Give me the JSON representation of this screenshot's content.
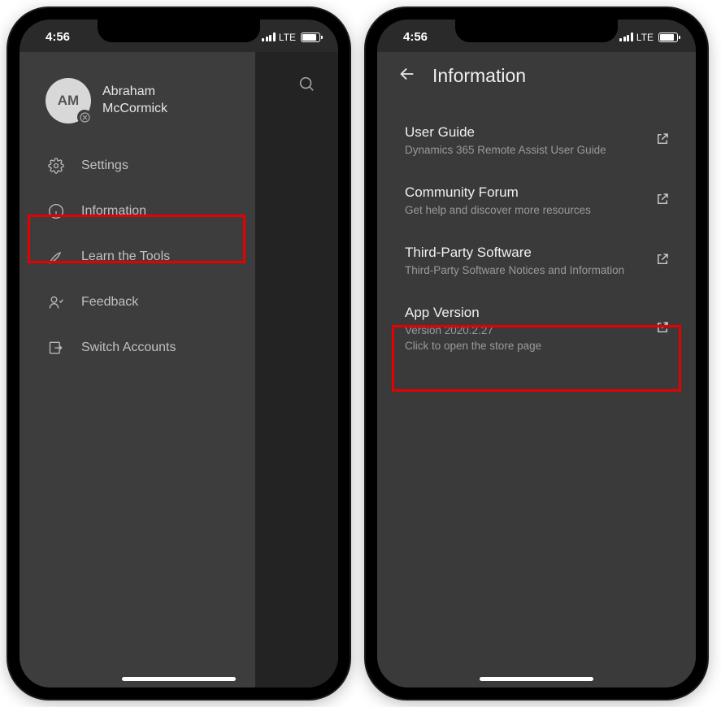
{
  "status": {
    "time": "4:56",
    "network": "LTE"
  },
  "left": {
    "avatar_initials": "AM",
    "user_first": "Abraham",
    "user_last": "McCormick",
    "menu": {
      "settings": "Settings",
      "information": "Information",
      "learn": "Learn the Tools",
      "feedback": "Feedback",
      "switch": "Switch Accounts"
    }
  },
  "right": {
    "header": "Information",
    "items": {
      "user_guide": {
        "title": "User Guide",
        "sub": "Dynamics 365 Remote Assist User Guide"
      },
      "community": {
        "title": "Community Forum",
        "sub": "Get help and discover more resources"
      },
      "third_party": {
        "title": "Third-Party Software",
        "sub": "Third-Party Software Notices and Information"
      },
      "app_version": {
        "title": "App Version",
        "sub1": "Version 2020.2.27",
        "sub2": "Click to open the store page"
      }
    }
  }
}
